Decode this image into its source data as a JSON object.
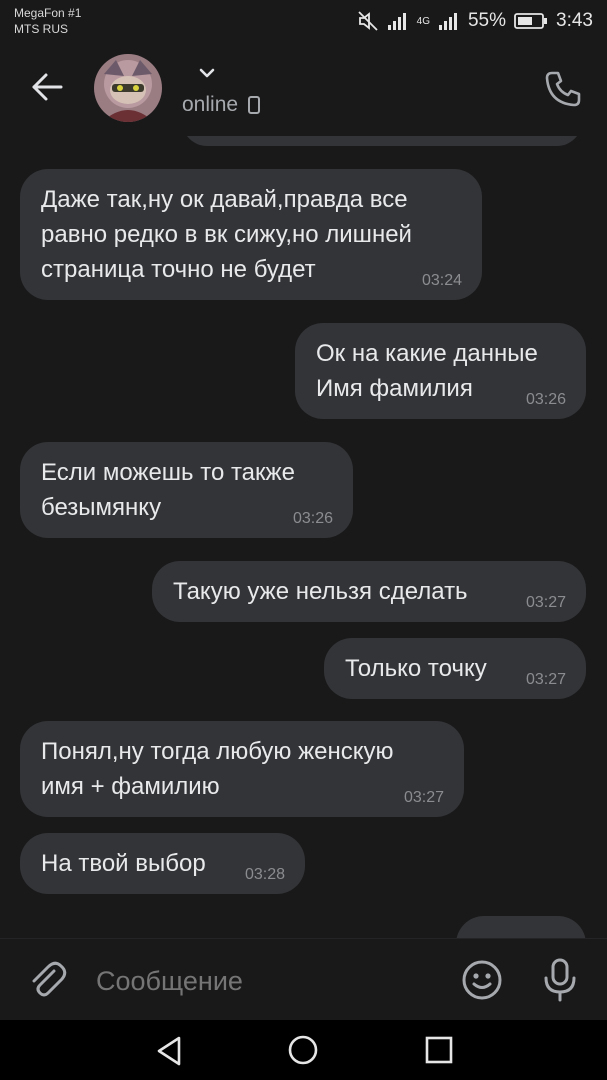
{
  "status_bar": {
    "carrier1": "MegaFon #1",
    "carrier2": "MTS RUS",
    "network": "4G",
    "battery": "55%",
    "time": "3:43",
    "icons": [
      "mute-icon",
      "signal-icon",
      "battery-icon"
    ]
  },
  "header": {
    "status": "online",
    "icons": [
      "back-arrow-icon",
      "chevron-down-icon",
      "phone-device-icon",
      "call-icon"
    ]
  },
  "messages": [
    {
      "side": "in",
      "text": "Даже так,ну ок давай,правда все\nравно редко в вк сижу,но лишней\nстраница точно не будет",
      "time": "03:24"
    },
    {
      "side": "out",
      "text": "Ок на какие данные\nИмя фамилия",
      "time": "03:26"
    },
    {
      "side": "in",
      "text": "Если можешь то также\nбезымянку",
      "time": "03:26"
    },
    {
      "side": "out",
      "text": "Такую уже нельзя сделать",
      "time": "03:27"
    },
    {
      "side": "out",
      "text": "Только точку",
      "time": "03:27"
    },
    {
      "side": "in",
      "text": "Понял,ну тогда любую женскую\nимя + фамилию",
      "time": "03:27"
    },
    {
      "side": "in",
      "text": "На твой выбор",
      "time": "03:28"
    }
  ],
  "composer": {
    "placeholder": "Сообщение",
    "icons": [
      "paperclip-icon",
      "emoji-icon",
      "microphone-icon"
    ]
  },
  "nav": {
    "icons": [
      "nav-back-icon",
      "nav-home-icon",
      "nav-recent-icon"
    ]
  },
  "colors": {
    "background": "#19191a",
    "bubble": "#333437",
    "text": "#e8e9eb",
    "secondary": "#a6a9ad"
  }
}
